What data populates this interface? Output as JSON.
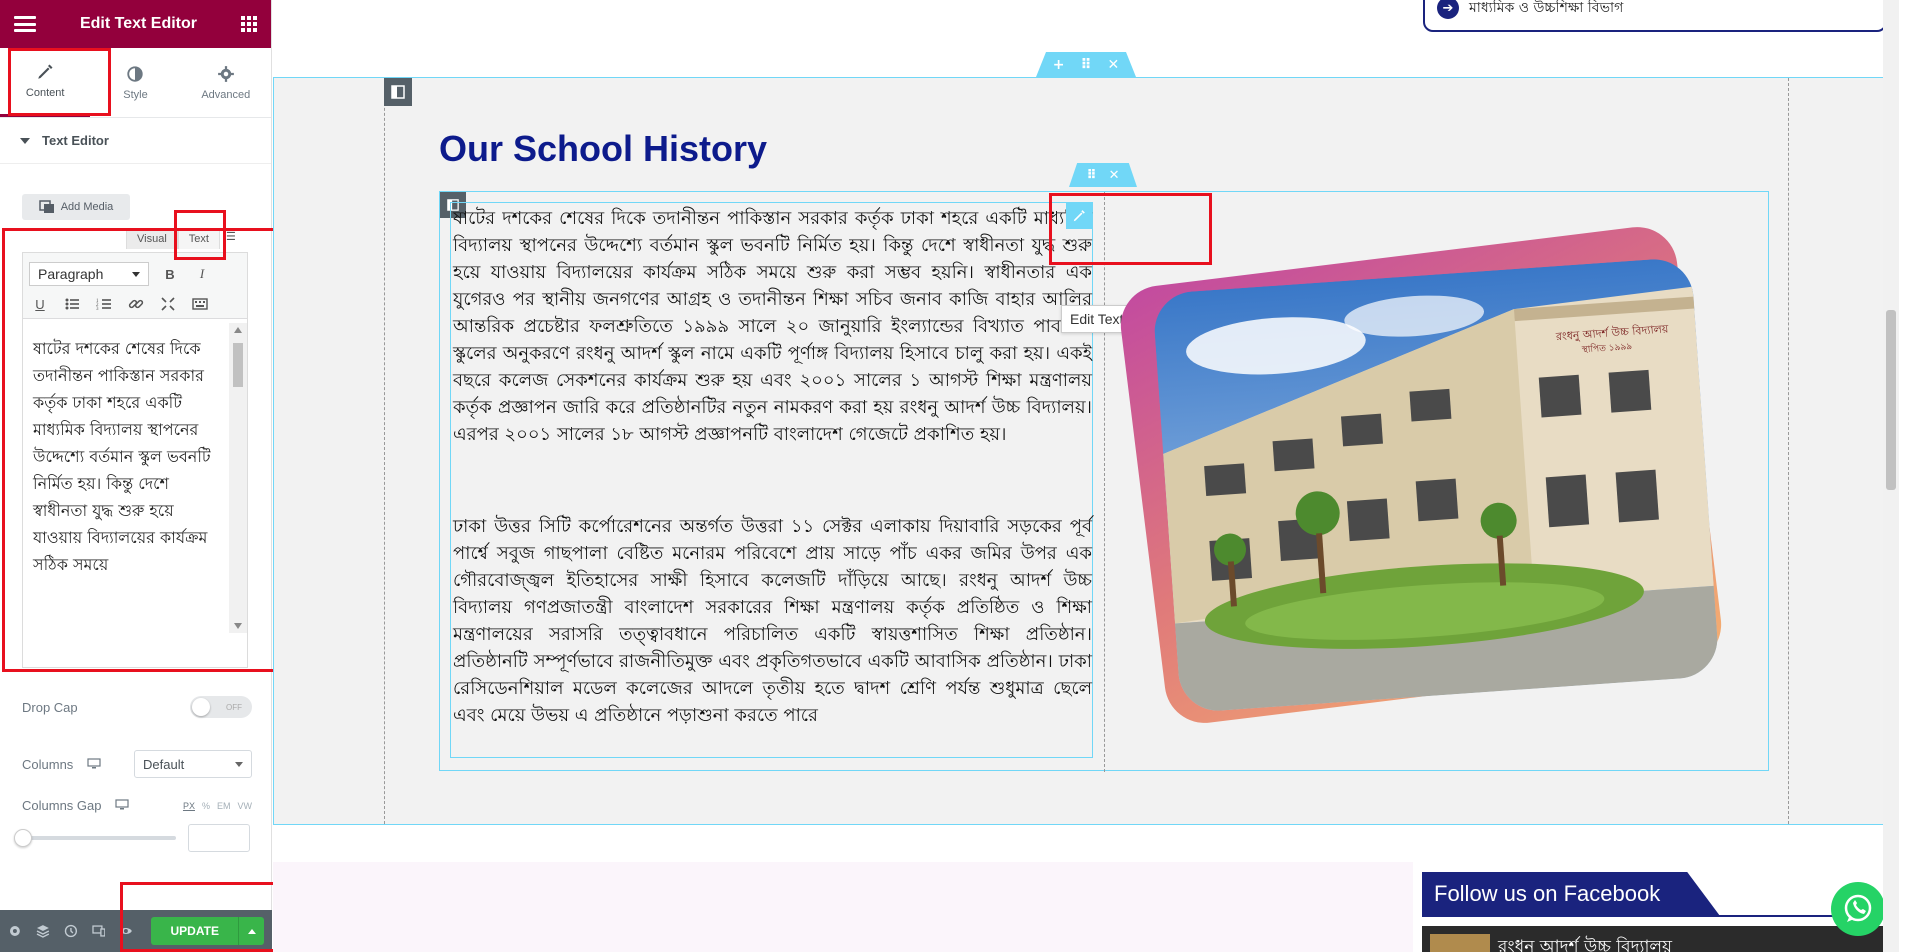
{
  "panel": {
    "title": "Edit Text Editor",
    "tabs": [
      {
        "label": "Content"
      },
      {
        "label": "Style"
      },
      {
        "label": "Advanced"
      }
    ],
    "section_title": "Text Editor",
    "add_media_label": "Add Media",
    "editor_tabs": {
      "visual": "Visual",
      "text": "Text"
    },
    "format_select": "Paragraph",
    "bold": "B",
    "italic": "I",
    "editor_content": "ষাটের দশকের শেষের দিকে তদানীন্তন পাকিস্তান সরকার কর্তৃক ঢাকা শহরে একটি মাধ্যমিক বিদ্যালয় স্থাপনের উদ্দেশ্যে বর্তমান স্কুল ভবনটি নির্মিত হয়। কিন্তু দেশে স্বাধীনতা যুদ্ধ শুরু হয়ে যাওয়ায় বিদ্যালয়ের কার্যক্রম সঠিক সময়ে",
    "drop_cap_label": "Drop Cap",
    "drop_cap_toggle": "OFF",
    "columns_label": "Columns",
    "columns_value": "Default",
    "columns_gap_label": "Columns Gap",
    "units": [
      "PX",
      "%",
      "EM",
      "VW"
    ],
    "update_label": "UPDATE"
  },
  "canvas": {
    "top_card_text": "মাধ্যমিক ও উচ্চশিক্ষা বিভাগ",
    "heading": "Our School History",
    "tooltip": "Edit Text Editor",
    "paragraph1": "ষাটের দশকের শেষের দিকে তদানীন্তন পাকিস্তান সরকার কর্তৃক ঢাকা শহরে একটি মাধ্যমিক বিদ্যালয় স্থাপনের উদ্দেশ্যে বর্তমান স্কুল ভবনটি নির্মিত হয়। কিন্তু দেশে স্বাধীনতা যুদ্ধ শুরু হয়ে যাওয়ায় বিদ্যালয়ের কার্যক্রম সঠিক সময়ে শুরু করা সম্ভব হয়নি। স্বাধীনতার এক যুগেরও পর স্থানীয় জনগণের আগ্রহ ও তদানীন্তন শিক্ষা সচিব জনাব কাজি বাহার আলির আন্তরিক প্রচেষ্টার ফলশ্রুতিতে ১৯৯৯ সালে ২০ জানুয়ারি ইংল্যান্ডের বিখ্যাত পাবলিক স্কুলের অনুকরণে রংধনু আদর্শ স্কুল নামে একটি পূর্ণাঙ্গ বিদ্যালয় হিসাবে চালু করা হয়। একই বছরে কলেজ সেকশনের কার্যক্রম শুরু হয় এবং ২০০১ সালের ১ আগস্ট শিক্ষা মন্ত্রণালয় কর্তৃক প্রজ্ঞাপন জারি করে প্রতিষ্ঠানটির নতুন নামকরণ করা হয় রংধনু আদর্শ উচ্চ বিদ্যালয়। এরপর ২০০১ সালের ১৮ আগস্ট প্রজ্ঞাপনটি বাংলাদেশ গেজেটে প্রকাশিত হয়।",
    "paragraph2": "ঢাকা উত্তর সিটি কর্পোরেশনের অন্তর্গত উত্তরা ১১ সেক্টর এলাকায় দিয়াবারি সড়কের পূর্ব পার্শ্বে সবুজ গাছপালা বেষ্টিত মনোরম পরিবেশে প্রায় সাড়ে পাঁচ একর জমির উপর এক গৌরবোজ্জ্বল ইতিহাসের সাক্ষী হিসাবে কলেজটি দাঁড়িয়ে আছে। রংধনু আদর্শ উচ্চ বিদ্যালয় গণপ্রজাতন্ত্রী বাংলাদেশ সরকারের শিক্ষা মন্ত্রণালয় কর্তৃক প্রতিষ্ঠিত ও শিক্ষা মন্ত্রণালয়ের সরাসরি তত্ত্বাবধানে পরিচালিত একটি স্বায়ত্তশাসিত শিক্ষা প্রতিষ্ঠান। প্রতিষ্ঠানটি সম্পূর্ণভাবে রাজনীতিমুক্ত এবং প্রকৃতিগতভাবে একটি আবাসিক প্রতিষ্ঠান। ঢাকা রেসিডেনশিয়াল মডেল কলেজের আদলে তৃতীয় হতে দ্বাদশ শ্রেণি পর্যন্ত শুধুমাত্র ছেলে এবং মেয়ে উভয় এ প্রতিষ্ঠানে পড়াশুনা করতে পারে",
    "building_sign": "রংধনু আদর্শ উচ্চ বিদ্যালয়",
    "building_sign_sub": "স্থাপিত ১৯৯৯",
    "fb_banner": "Follow us on Facebook",
    "fb_card_text": "রংধনু আদর্শ উচ্চ বিদ্যালয়"
  },
  "colors": {
    "panel_header": "#93003c",
    "accent_blue": "#71d7f7",
    "heading_blue": "#0d1b8c",
    "update_green": "#39b54a",
    "highlight_red": "#e8101e"
  }
}
